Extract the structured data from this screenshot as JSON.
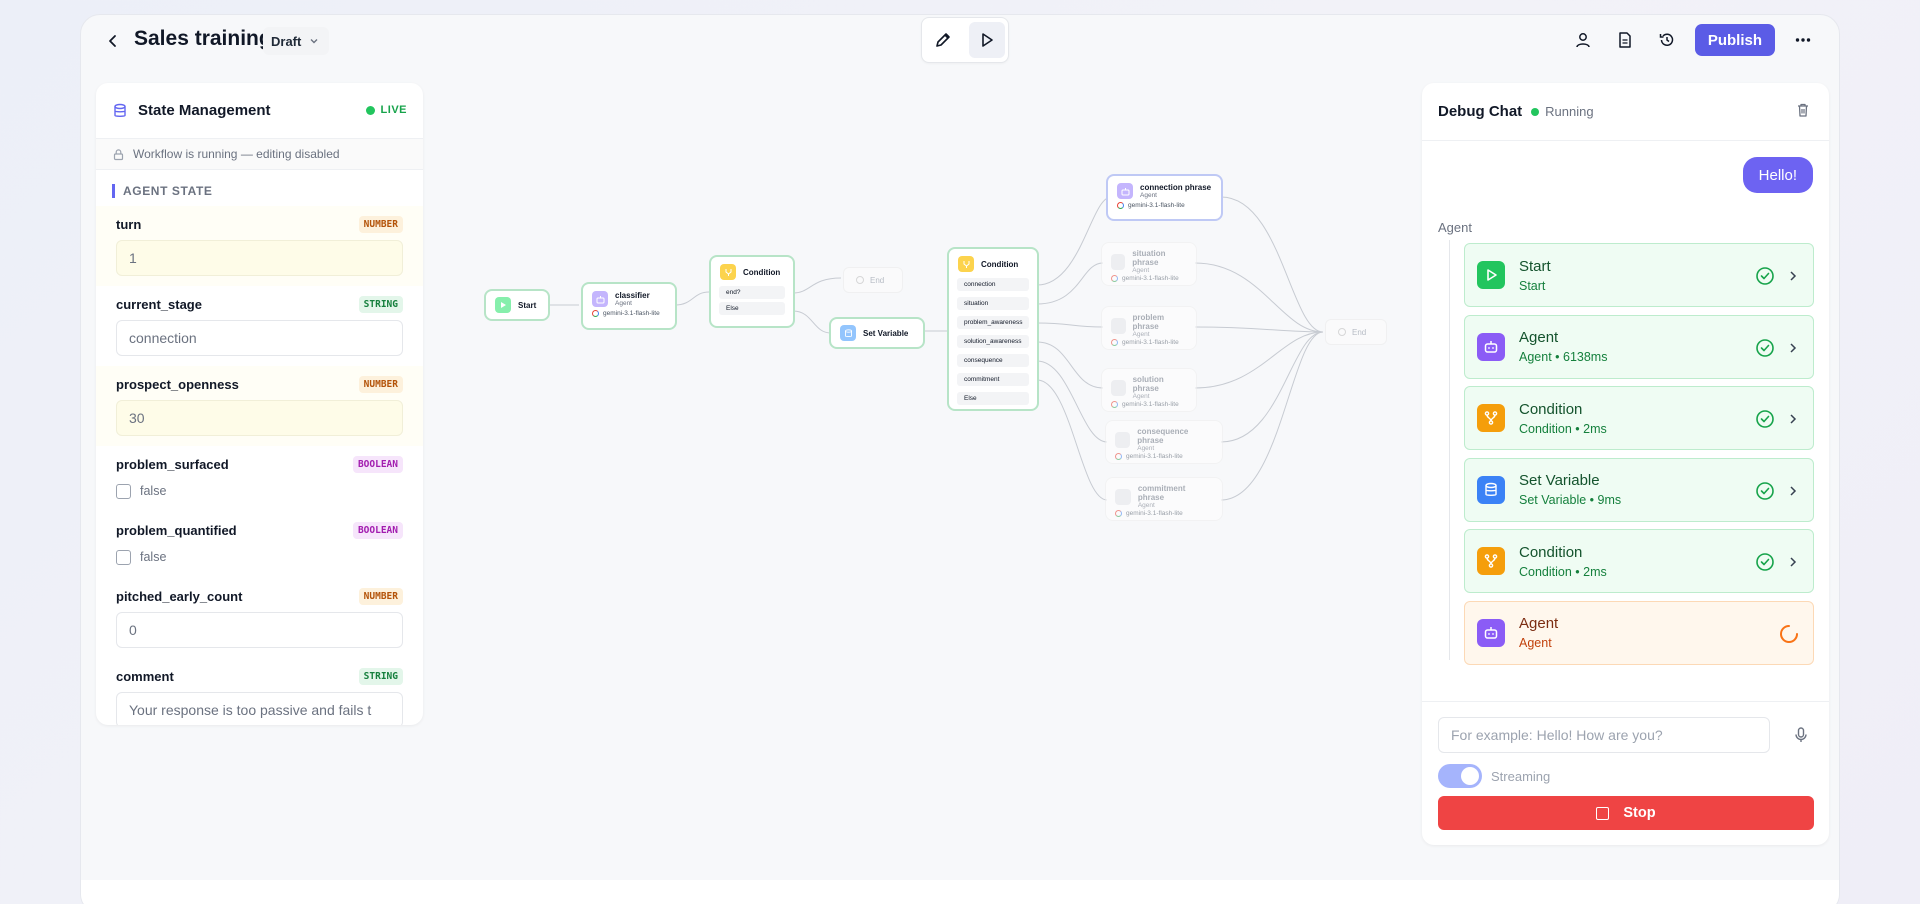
{
  "header": {
    "title": "Sales training",
    "status": "Draft",
    "publish_label": "Publish"
  },
  "state_panel": {
    "title": "State Management",
    "live_label": "LIVE",
    "lock_message": "Workflow is running — editing disabled",
    "section_title": "AGENT STATE",
    "fields": [
      {
        "name": "turn",
        "type": "NUMBER",
        "value": "1"
      },
      {
        "name": "current_stage",
        "type": "STRING",
        "value": "connection"
      },
      {
        "name": "prospect_openness",
        "type": "NUMBER",
        "value": "30"
      },
      {
        "name": "problem_surfaced",
        "type": "BOOLEAN",
        "value": "false"
      },
      {
        "name": "problem_quantified",
        "type": "BOOLEAN",
        "value": "false"
      },
      {
        "name": "pitched_early_count",
        "type": "NUMBER",
        "value": "0"
      },
      {
        "name": "comment",
        "type": "STRING",
        "value": "Your response is too passive and fails t"
      }
    ]
  },
  "canvas": {
    "start": {
      "title": "Start"
    },
    "classifier": {
      "title": "classifier",
      "subtitle": "Agent",
      "model": "gemini-3.1-flash-lite"
    },
    "condition1": {
      "title": "Condition",
      "branches": [
        "end?",
        "Else"
      ]
    },
    "end1": {
      "title": "End"
    },
    "set_variable": {
      "title": "Set Variable"
    },
    "condition2": {
      "title": "Condition",
      "branches": [
        "connection",
        "situation",
        "problem_awareness",
        "solution_awareness",
        "consequence",
        "commitment",
        "Else"
      ]
    },
    "phrases": [
      {
        "title": "connection phrase",
        "subtitle": "Agent",
        "model": "gemini-3.1-flash-lite"
      },
      {
        "title": "situation phrase",
        "subtitle": "Agent",
        "model": "gemini-3.1-flash-lite"
      },
      {
        "title": "problem phrase",
        "subtitle": "Agent",
        "model": "gemini-3.1-flash-lite"
      },
      {
        "title": "solution phrase",
        "subtitle": "Agent",
        "model": "gemini-3.1-flash-lite"
      },
      {
        "title": "consequence phrase",
        "subtitle": "Agent",
        "model": "gemini-3.1-flash-lite"
      },
      {
        "title": "commitment phrase",
        "subtitle": "Agent",
        "model": "gemini-3.1-flash-lite"
      }
    ],
    "end2": {
      "title": "End"
    }
  },
  "debug_chat": {
    "title": "Debug Chat",
    "status": "Running",
    "user_message": "Hello!",
    "agent_label": "Agent",
    "steps": [
      {
        "title": "Start",
        "subtitle": "Start",
        "duration": "",
        "state": "done",
        "icon": "play-icon",
        "color": "#22c55e"
      },
      {
        "title": "Agent",
        "subtitle": "Agent",
        "duration": "6138ms",
        "state": "done",
        "icon": "bot-icon",
        "color": "#8b5cf6"
      },
      {
        "title": "Condition",
        "subtitle": "Condition",
        "duration": "2ms",
        "state": "done",
        "icon": "branch-icon",
        "color": "#f59e0b"
      },
      {
        "title": "Set Variable",
        "subtitle": "Set Variable",
        "duration": "9ms",
        "state": "done",
        "icon": "database-icon",
        "color": "#3b82f6"
      },
      {
        "title": "Condition",
        "subtitle": "Condition",
        "duration": "2ms",
        "state": "done",
        "icon": "branch-icon",
        "color": "#f59e0b"
      },
      {
        "title": "Agent",
        "subtitle": "Agent",
        "duration": "",
        "state": "running",
        "icon": "bot-icon",
        "color": "#8b5cf6"
      }
    ],
    "input_placeholder": "For example: Hello! How are you?",
    "streaming_label": "Streaming",
    "streaming_on": true,
    "stop_label": "Stop"
  }
}
